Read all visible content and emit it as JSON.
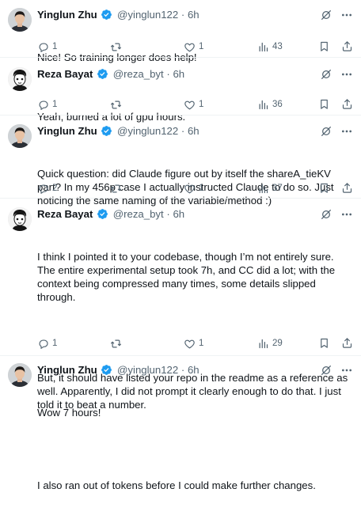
{
  "tweets": [
    {
      "author_name": "Yinglun Zhu",
      "handle": "@yinglun122",
      "dot": "·",
      "time": "6h",
      "paragraphs": [
        "Nice! So training longer does help!"
      ],
      "replies": "1",
      "retweets": "",
      "likes": "1",
      "views": "43",
      "avatar": "person-photo-icon"
    },
    {
      "author_name": "Reza Bayat",
      "handle": "@reza_byt",
      "dot": "·",
      "time": "6h",
      "paragraphs": [
        "Yeah, burned a lot of gpu hours."
      ],
      "replies": "1",
      "retweets": "",
      "likes": "1",
      "views": "36",
      "avatar": "sketch-avatar-icon"
    },
    {
      "author_name": "Yinglun Zhu",
      "handle": "@yinglun122",
      "dot": "·",
      "time": "6h",
      "paragraphs": [
        "Quick question: did Claude figure out by itself the shareA_tieKV part? In my 456p case I actually instructed Claude to do so. Just noticing the same naming of the variable/method :)"
      ],
      "replies": "2",
      "retweets": "",
      "likes": "1",
      "views": "37",
      "avatar": "person-photo-icon"
    },
    {
      "author_name": "Reza Bayat",
      "handle": "@reza_byt",
      "dot": "·",
      "time": "6h",
      "paragraphs": [
        "I think I pointed it to your codebase, though I’m not entirely sure. The entire experimental setup took 7h, and CC did a lot; with the context being compressed many times, some details slipped through.",
        "But, it should have listed your repo in the readme as a reference as well. Apparently, I did not prompt it clearly enough to do that. I just told it to beat a number.",
        "I also ran out of tokens before I could make further changes."
      ],
      "replies": "1",
      "retweets": "",
      "likes": "1",
      "views": "29",
      "avatar": "sketch-avatar-icon"
    },
    {
      "author_name": "Yinglun Zhu",
      "handle": "@yinglun122",
      "dot": "·",
      "time": "6h",
      "paragraphs": [
        "Wow 7 hours!"
      ],
      "avatar": "person-photo-icon"
    }
  ],
  "colors": {
    "text": "#0f1419",
    "secondary": "#536471",
    "verified": "#1d9bf0",
    "divider": "#eff3f4"
  },
  "icons": {
    "verified": "verified-badge-icon",
    "grok": "grok-icon",
    "more": "more-icon",
    "reply": "reply-icon",
    "retweet": "retweet-icon",
    "like": "like-icon",
    "views": "views-icon",
    "bookmark": "bookmark-icon",
    "share": "share-icon"
  }
}
